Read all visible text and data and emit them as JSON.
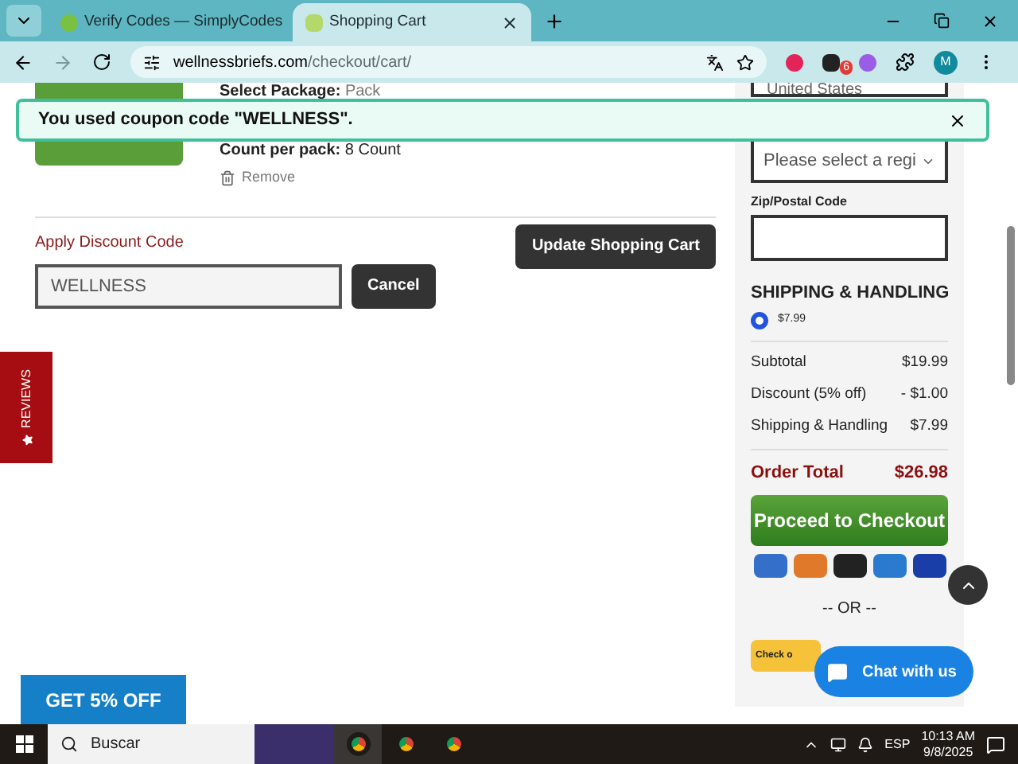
{
  "browser": {
    "tabs": [
      {
        "title": "Verify Codes — SimplyCodes",
        "selected": false
      },
      {
        "title": "Shopping Cart",
        "selected": true
      }
    ],
    "url_domain": "wellnessbriefs.com",
    "url_path": "/checkout/cart/",
    "extension_badge": "6",
    "profile": "M"
  },
  "alert": {
    "text": "You used coupon code \"WELLNESS\"."
  },
  "product": {
    "package_label": "Select Package:",
    "package_value": "Pack",
    "count_label": "Count per pack:",
    "count_value": "8 Count",
    "remove": "Remove"
  },
  "discount": {
    "label": "Apply Discount Code",
    "value": "WELLNESS",
    "cancel": "Cancel",
    "update": "Update Shopping Cart"
  },
  "reviews_tab": "REVIEWS",
  "summary": {
    "country": "United States",
    "region_placeholder": "Please select a regi",
    "zip_label": "Zip/Postal Code",
    "shipping_title": "SHIPPING & HANDLING",
    "shipping_options": [
      {
        "price": "$7.99",
        "selected": true
      }
    ],
    "lines": [
      {
        "label": "Subtotal",
        "value": "$19.99"
      },
      {
        "label": "Discount (5% off)",
        "value": "- $1.00"
      },
      {
        "label": "Shipping & Handling",
        "value": "$7.99"
      }
    ],
    "total_label": "Order Total",
    "total_value": "$26.98",
    "checkout": "Proceed to Checkout",
    "or": "-- OR --",
    "alt_checkout": "Check o"
  },
  "promo": "GET 5% OFF",
  "chat": "Chat with us",
  "taskbar": {
    "search": "Buscar",
    "language": "ESP",
    "time": "10:13 AM",
    "date": "9/8/2025"
  }
}
